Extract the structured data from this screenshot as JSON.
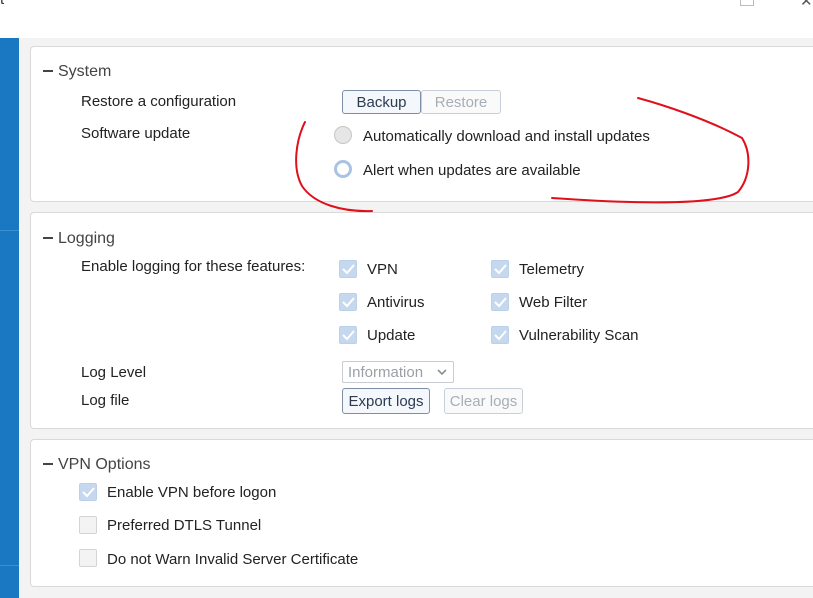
{
  "window": {
    "title_fragment": "t",
    "close_glyph": "✕"
  },
  "colors": {
    "accent": "#1a78c2",
    "annotation": "#e0101a",
    "checkbox_checked": "#c5d8ee"
  },
  "system": {
    "title": "System",
    "restore_label": "Restore a configuration",
    "backup_button": "Backup",
    "restore_button": "Restore",
    "software_update_label": "Software update",
    "options": [
      {
        "label": "Automatically download and install updates",
        "selected": false
      },
      {
        "label": "Alert when updates are available",
        "selected": true
      }
    ]
  },
  "logging": {
    "title": "Logging",
    "enable_label": "Enable logging for these features:",
    "features": [
      {
        "label": "VPN",
        "checked": true
      },
      {
        "label": "Telemetry",
        "checked": true
      },
      {
        "label": "Antivirus",
        "checked": true
      },
      {
        "label": "Web Filter",
        "checked": true
      },
      {
        "label": "Update",
        "checked": true
      },
      {
        "label": "Vulnerability Scan",
        "checked": true
      }
    ],
    "log_level_label": "Log Level",
    "log_level_value": "Information",
    "log_file_label": "Log file",
    "export_button": "Export logs",
    "clear_button": "Clear logs"
  },
  "vpn": {
    "title": "VPN Options",
    "options": [
      {
        "label": "Enable VPN before logon",
        "checked": true
      },
      {
        "label": "Preferred DTLS Tunnel",
        "checked": false
      },
      {
        "label": "Do not Warn Invalid Server Certificate",
        "checked": false
      }
    ]
  }
}
